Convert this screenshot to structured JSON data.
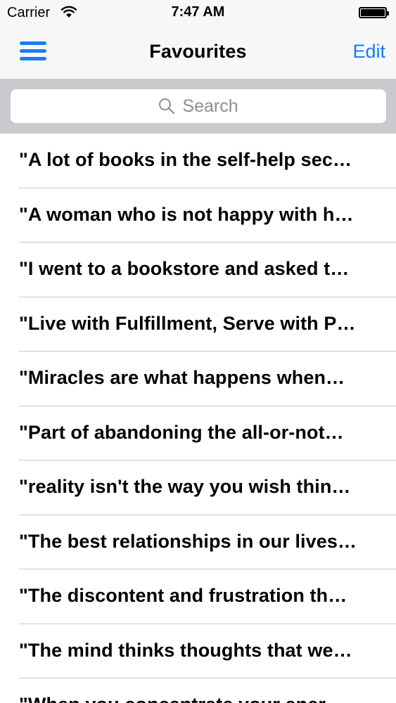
{
  "status_bar": {
    "carrier": "Carrier",
    "time": "7:47 AM"
  },
  "nav": {
    "title": "Favourites",
    "edit_label": "Edit",
    "menu_icon": "hamburger-menu-icon"
  },
  "search": {
    "placeholder": "Search"
  },
  "colors": {
    "accent": "#1a7cf5",
    "separator": "#c8c7cc",
    "search_bar_bg": "#c9c9ce"
  },
  "favourites": [
    "\"A lot of books in the self-help sec…",
    "\"A woman who is not happy with h…",
    "\"I went to a bookstore and asked t…",
    "\"Live with Fulfillment, Serve with P…",
    "\"Miracles are what happens when…",
    "\"Part of abandoning the all-or-not…",
    "\"reality isn't the way you wish thin…",
    "\"The best relationships in our lives…",
    "\"The discontent and frustration th…",
    "\"The mind thinks thoughts that we…",
    "\"When you concentrate your ener…"
  ]
}
